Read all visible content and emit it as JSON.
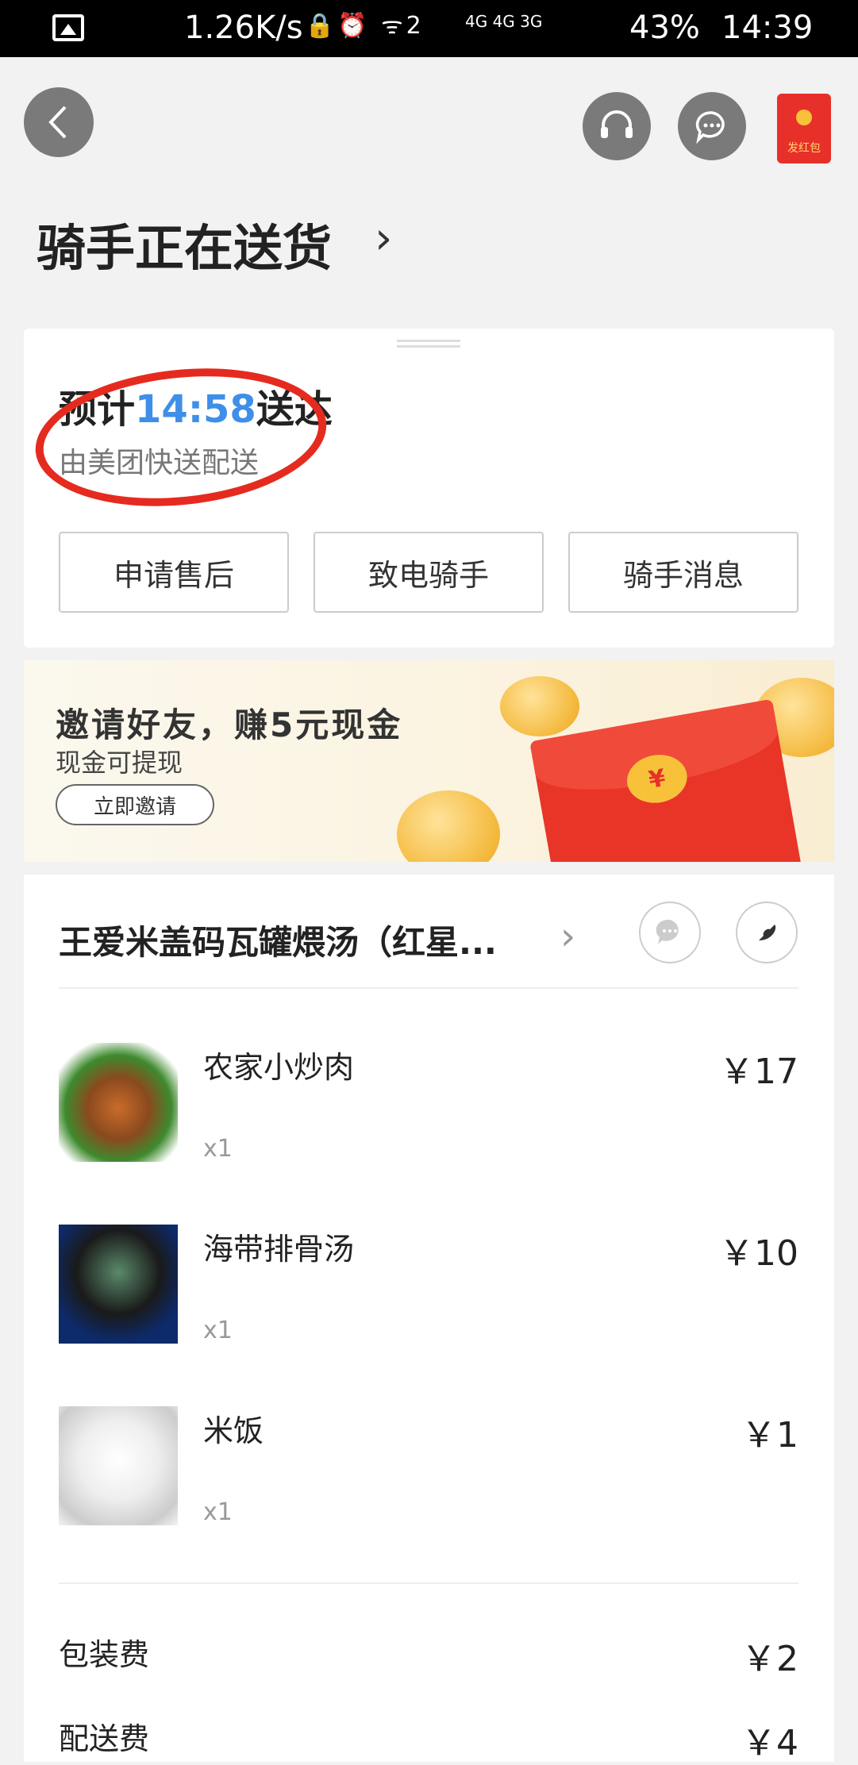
{
  "status_bar": {
    "speed": "1.26K/s",
    "icons": "🔒⏰ ᯤ2",
    "network": "4G 4G 3G",
    "battery": "43%",
    "time": "14:39"
  },
  "header": {
    "title": "骑手正在送货",
    "redpack_label": "发红包"
  },
  "delivery_card": {
    "eta_prefix": "预计",
    "eta_time": "14:58",
    "eta_suffix": "送达",
    "courier": "由美团快送配送",
    "buttons": [
      "申请售后",
      "致电骑手",
      "骑手消息"
    ]
  },
  "banner": {
    "title": "邀请好友，赚5元现金",
    "subtitle": "现金可提现",
    "button": "立即邀请",
    "coin_symbol": "¥"
  },
  "order": {
    "store_name": "王爱米盖码瓦罐煨汤（红星...",
    "items": [
      {
        "name": "农家小炒肉",
        "qty": "x1",
        "price": "￥17"
      },
      {
        "name": "海带排骨汤",
        "qty": "x1",
        "price": "￥10"
      },
      {
        "name": "米饭",
        "qty": "x1",
        "price": "￥1"
      }
    ],
    "fees": [
      {
        "label": "包装费",
        "value": "￥2"
      },
      {
        "label": "配送费",
        "value": "￥4"
      }
    ]
  },
  "colors": {
    "accent_blue": "#3f8fe8",
    "annotation_red": "#e52b1f"
  }
}
